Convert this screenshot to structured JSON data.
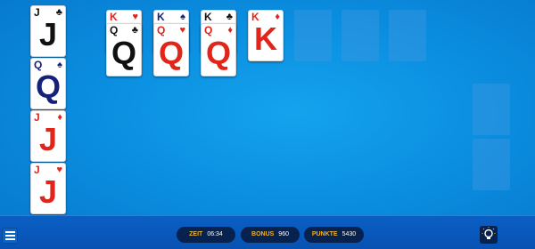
{
  "tableau_left": [
    {
      "rank": "J",
      "suit": "♣",
      "color": "black"
    },
    {
      "rank": "Q",
      "suit": "♠",
      "color": "navy"
    },
    {
      "rank": "J",
      "suit": "♦",
      "color": "red"
    },
    {
      "rank": "J",
      "suit": "♥",
      "color": "red"
    }
  ],
  "top_row": [
    {
      "rank": "Q",
      "suit": "♣",
      "color": "black",
      "behind_rank": "K",
      "behind_suit": "♥",
      "behind_color": "red"
    },
    {
      "rank": "Q",
      "suit": "♥",
      "color": "red",
      "behind_rank": "K",
      "behind_suit": "♠",
      "behind_color": "navy"
    },
    {
      "rank": "Q",
      "suit": "♦",
      "color": "red",
      "behind_rank": "K",
      "behind_suit": "♣",
      "behind_color": "black"
    },
    {
      "rank": "K",
      "suit": "♦",
      "color": "red"
    }
  ],
  "status": {
    "zeit_label": "ZEIT",
    "zeit_value": "06:34",
    "bonus_label": "BONUS",
    "bonus_value": "960",
    "punkte_label": "PUNKTE",
    "punkte_value": "5430"
  },
  "icons": {
    "menu": "menu-icon",
    "hint": "lightbulb-icon"
  },
  "colors": {
    "red": "#e0251b",
    "black": "#111111",
    "navy": "#17217a",
    "label": "#f3b21c",
    "pill": "#08224f"
  }
}
